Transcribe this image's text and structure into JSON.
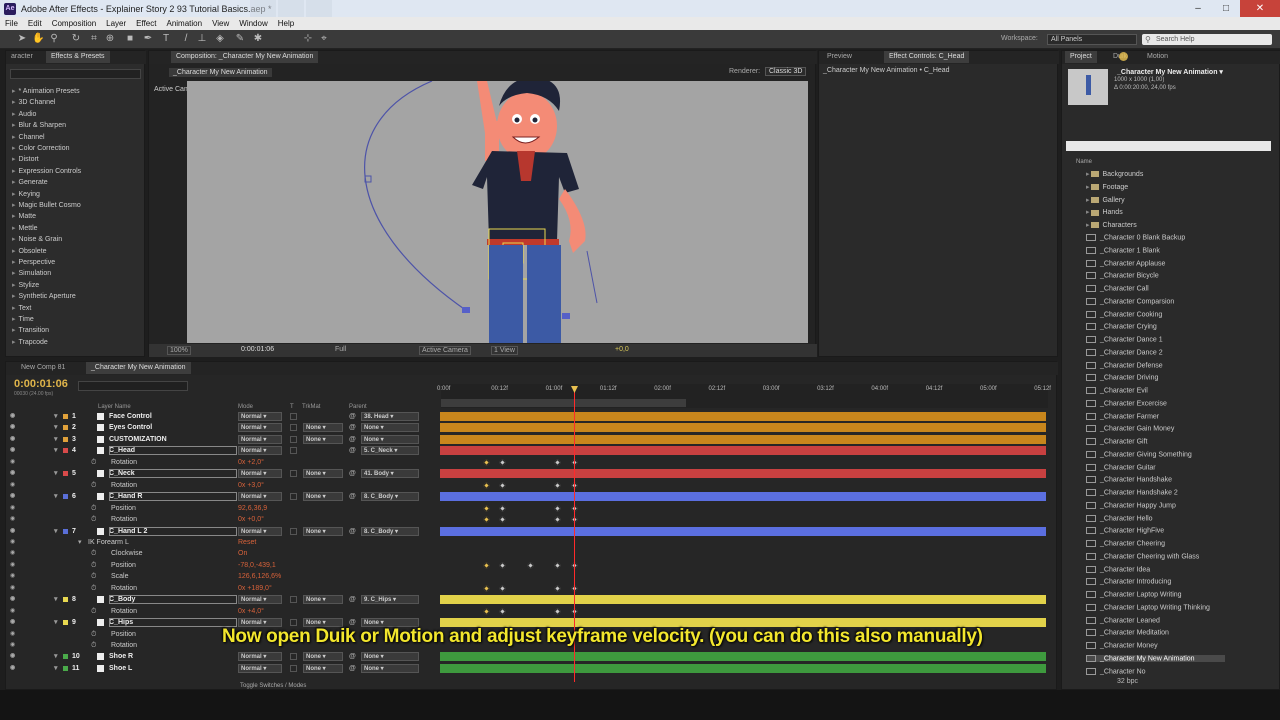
{
  "window": {
    "title": "Adobe After Effects - Explainer Story 2 93 Tutorial Basics.aep *"
  },
  "menu": [
    "File",
    "Edit",
    "Composition",
    "Layer",
    "Effect",
    "Animation",
    "View",
    "Window",
    "Help"
  ],
  "toolbar": {
    "workspace_label": "Workspace:",
    "workspace_value": "All Panels",
    "search_placeholder": "Search Help"
  },
  "effects_panel": {
    "tab_left": "aracter",
    "tab": "Effects & Presets",
    "items": [
      "* Animation Presets",
      "3D Channel",
      "Audio",
      "Blur & Sharpen",
      "Channel",
      "Color Correction",
      "Distort",
      "Expression Controls",
      "Generate",
      "Keying",
      "Magic Bullet Cosmo",
      "Matte",
      "Mettle",
      "Noise & Grain",
      "Obsolete",
      "Perspective",
      "Simulation",
      "Stylize",
      "Synthetic Aperture",
      "Text",
      "Time",
      "Transition",
      "Trapcode"
    ]
  },
  "comp_panel": {
    "tab": "Composition: _Character My New Animation",
    "subtab": "_Character My New Animation",
    "renderer_label": "Renderer:",
    "renderer": "Classic 3D",
    "camera_label": "Active Camera",
    "zoom": "100%",
    "timecode": "0:00:01:06",
    "resolution": "Full",
    "camera": "Active Camera",
    "view": "1 View",
    "offset": "+0,0"
  },
  "fx_panel": {
    "tab_preview": "Preview",
    "tab": "Effect Controls: C_Head",
    "path": "_Character My New Animation • C_Head"
  },
  "project_panel": {
    "tab": "Project",
    "tab2": "Duik",
    "tab3": "Motion",
    "comp_name": "_Character My New Animation ▾",
    "comp_size": "1000 x 1000 (1,00)",
    "comp_dur": "Δ 0:00:20:00, 24,00 fps",
    "name_col": "Name",
    "folders": [
      "Backgrounds",
      "Footage",
      "Gallery",
      "Hands",
      "Characters"
    ],
    "files": [
      "_Character 0 Blank Backup",
      "_Character 1 Blank",
      "_Character Applause",
      "_Character Bicycle",
      "_Character Call",
      "_Character Comparsion",
      "_Character Cooking",
      "_Character Crying",
      "_Character Dance 1",
      "_Character Dance 2",
      "_Character Defense",
      "_Character Driving",
      "_Character Evil",
      "_Character Excercise",
      "_Character Farmer",
      "_Character Gain Money",
      "_Character Gift",
      "_Character Giving Something",
      "_Character Guitar",
      "_Character Handshake",
      "_Character Handshake 2",
      "_Character Happy Jump",
      "_Character Hello",
      "_Character HighFive",
      "_Character Cheering",
      "_Character Cheering with Glass",
      "_Character Idea",
      "_Character Introducing",
      "_Character Laptop Writing",
      "_Character Laptop Writing Thinking",
      "_Character Leaned",
      "_Character Meditation",
      "_Character Money",
      "_Character My New Animation",
      "_Character No"
    ],
    "bpc": "32 bpc"
  },
  "timeline": {
    "tab1": "New Comp 81",
    "tab2": "_Character My New Animation",
    "timecode": "0:00:01:06",
    "fps_note": "00030 (24.00 fps)",
    "col_layer": "Layer Name",
    "col_mode": "Mode",
    "col_t": "T",
    "col_trk": "TrkMat",
    "col_parent": "Parent",
    "ruler": [
      "0:00f",
      "00:12f",
      "01:00f",
      "01:12f",
      "02:00f",
      "02:12f",
      "03:00f",
      "03:12f",
      "04:00f",
      "04:12f",
      "05:00f",
      "05:12f"
    ],
    "toggle": "Toggle Switches / Modes",
    "rows": [
      {
        "type": "layer",
        "num": "1",
        "name": "Face Control",
        "mode": "Normal",
        "trk": "",
        "parent": "38. Head",
        "color": "#e0a13a",
        "bar": "#c8861c"
      },
      {
        "type": "layer",
        "num": "2",
        "name": "Eyes Control",
        "mode": "Normal",
        "trk": "None",
        "parent": "None",
        "color": "#e0a13a",
        "bar": "#c8861c"
      },
      {
        "type": "layer",
        "num": "3",
        "name": "CUSTOMIZATION",
        "mode": "Normal",
        "trk": "None",
        "parent": "None",
        "color": "#e0a13a",
        "bar": "#c8861c"
      },
      {
        "type": "layer",
        "num": "4",
        "name": "C_Head",
        "mode": "Normal",
        "trk": "",
        "parent": "5. C_Neck",
        "color": "#d84a4a",
        "bar": "#c84040",
        "boxed": true
      },
      {
        "type": "prop",
        "name": "Rotation",
        "value": "0x +2,0°",
        "kf": [
          486,
          502,
          557,
          574
        ]
      },
      {
        "type": "layer",
        "num": "5",
        "name": "C_Neck",
        "mode": "Normal",
        "trk": "None",
        "parent": "41. Body",
        "color": "#d84a4a",
        "bar": "#c84040",
        "boxed": true
      },
      {
        "type": "prop",
        "name": "Rotation",
        "value": "0x +3,0°",
        "kf": [
          486,
          502,
          557,
          574
        ]
      },
      {
        "type": "layer",
        "num": "6",
        "name": "C_Hand R",
        "mode": "Normal",
        "trk": "None",
        "parent": "8. C_Body",
        "color": "#5a6fd8",
        "bar": "#5b6fe0",
        "boxed": true
      },
      {
        "type": "prop",
        "name": "Position",
        "value": "92,6,36,9",
        "kf": [
          486,
          502,
          557,
          574
        ]
      },
      {
        "type": "prop",
        "name": "Rotation",
        "value": "0x +0,0°",
        "kf": [
          486,
          502,
          557,
          574
        ]
      },
      {
        "type": "layer",
        "num": "7",
        "name": "C_Hand L 2",
        "mode": "Normal",
        "trk": "None",
        "parent": "8. C_Body",
        "color": "#5a6fd8",
        "bar": "#5b6fe0",
        "boxed": true
      },
      {
        "type": "sub",
        "name": "IK Forearm L",
        "value": "Reset"
      },
      {
        "type": "prop",
        "name": "Clockwise",
        "value": "On",
        "kf": []
      },
      {
        "type": "prop",
        "name": "Position",
        "value": "-78,0,-439,1",
        "kf": [
          486,
          502,
          530,
          557,
          574
        ]
      },
      {
        "type": "prop",
        "name": "Scale",
        "value": "126,6,126,6%",
        "kf": []
      },
      {
        "type": "prop",
        "name": "Rotation",
        "value": "0x +189,0°",
        "kf": [
          486,
          502,
          557,
          574
        ]
      },
      {
        "type": "layer",
        "num": "8",
        "name": "C_Body",
        "mode": "Normal",
        "trk": "None",
        "parent": "9. C_Hips",
        "color": "#e8d850",
        "bar": "#e2d24a",
        "boxed": true
      },
      {
        "type": "prop",
        "name": "Rotation",
        "value": "0x +4,0°",
        "kf": [
          486,
          502,
          557,
          574
        ]
      },
      {
        "type": "layer",
        "num": "9",
        "name": "C_Hips",
        "mode": "Normal",
        "trk": "None",
        "parent": "None",
        "color": "#e8d850",
        "bar": "#e2d24a",
        "boxed": true
      },
      {
        "type": "prop",
        "name": "Position",
        "value": "",
        "kf": []
      },
      {
        "type": "prop",
        "name": "Rotation",
        "value": "",
        "kf": []
      },
      {
        "type": "layer",
        "num": "10",
        "name": "Shoe R",
        "mode": "Normal",
        "trk": "None",
        "parent": "None",
        "color": "#4aaa4a",
        "bar": "#3e9a3e"
      },
      {
        "type": "layer",
        "num": "11",
        "name": "Shoe L",
        "mode": "Normal",
        "trk": "None",
        "parent": "None",
        "color": "#4aaa4a",
        "bar": "#3e9a3e"
      }
    ]
  },
  "caption": "Now open Duik or Motion and adjust keyframe velocity. (you can do this also manually)"
}
